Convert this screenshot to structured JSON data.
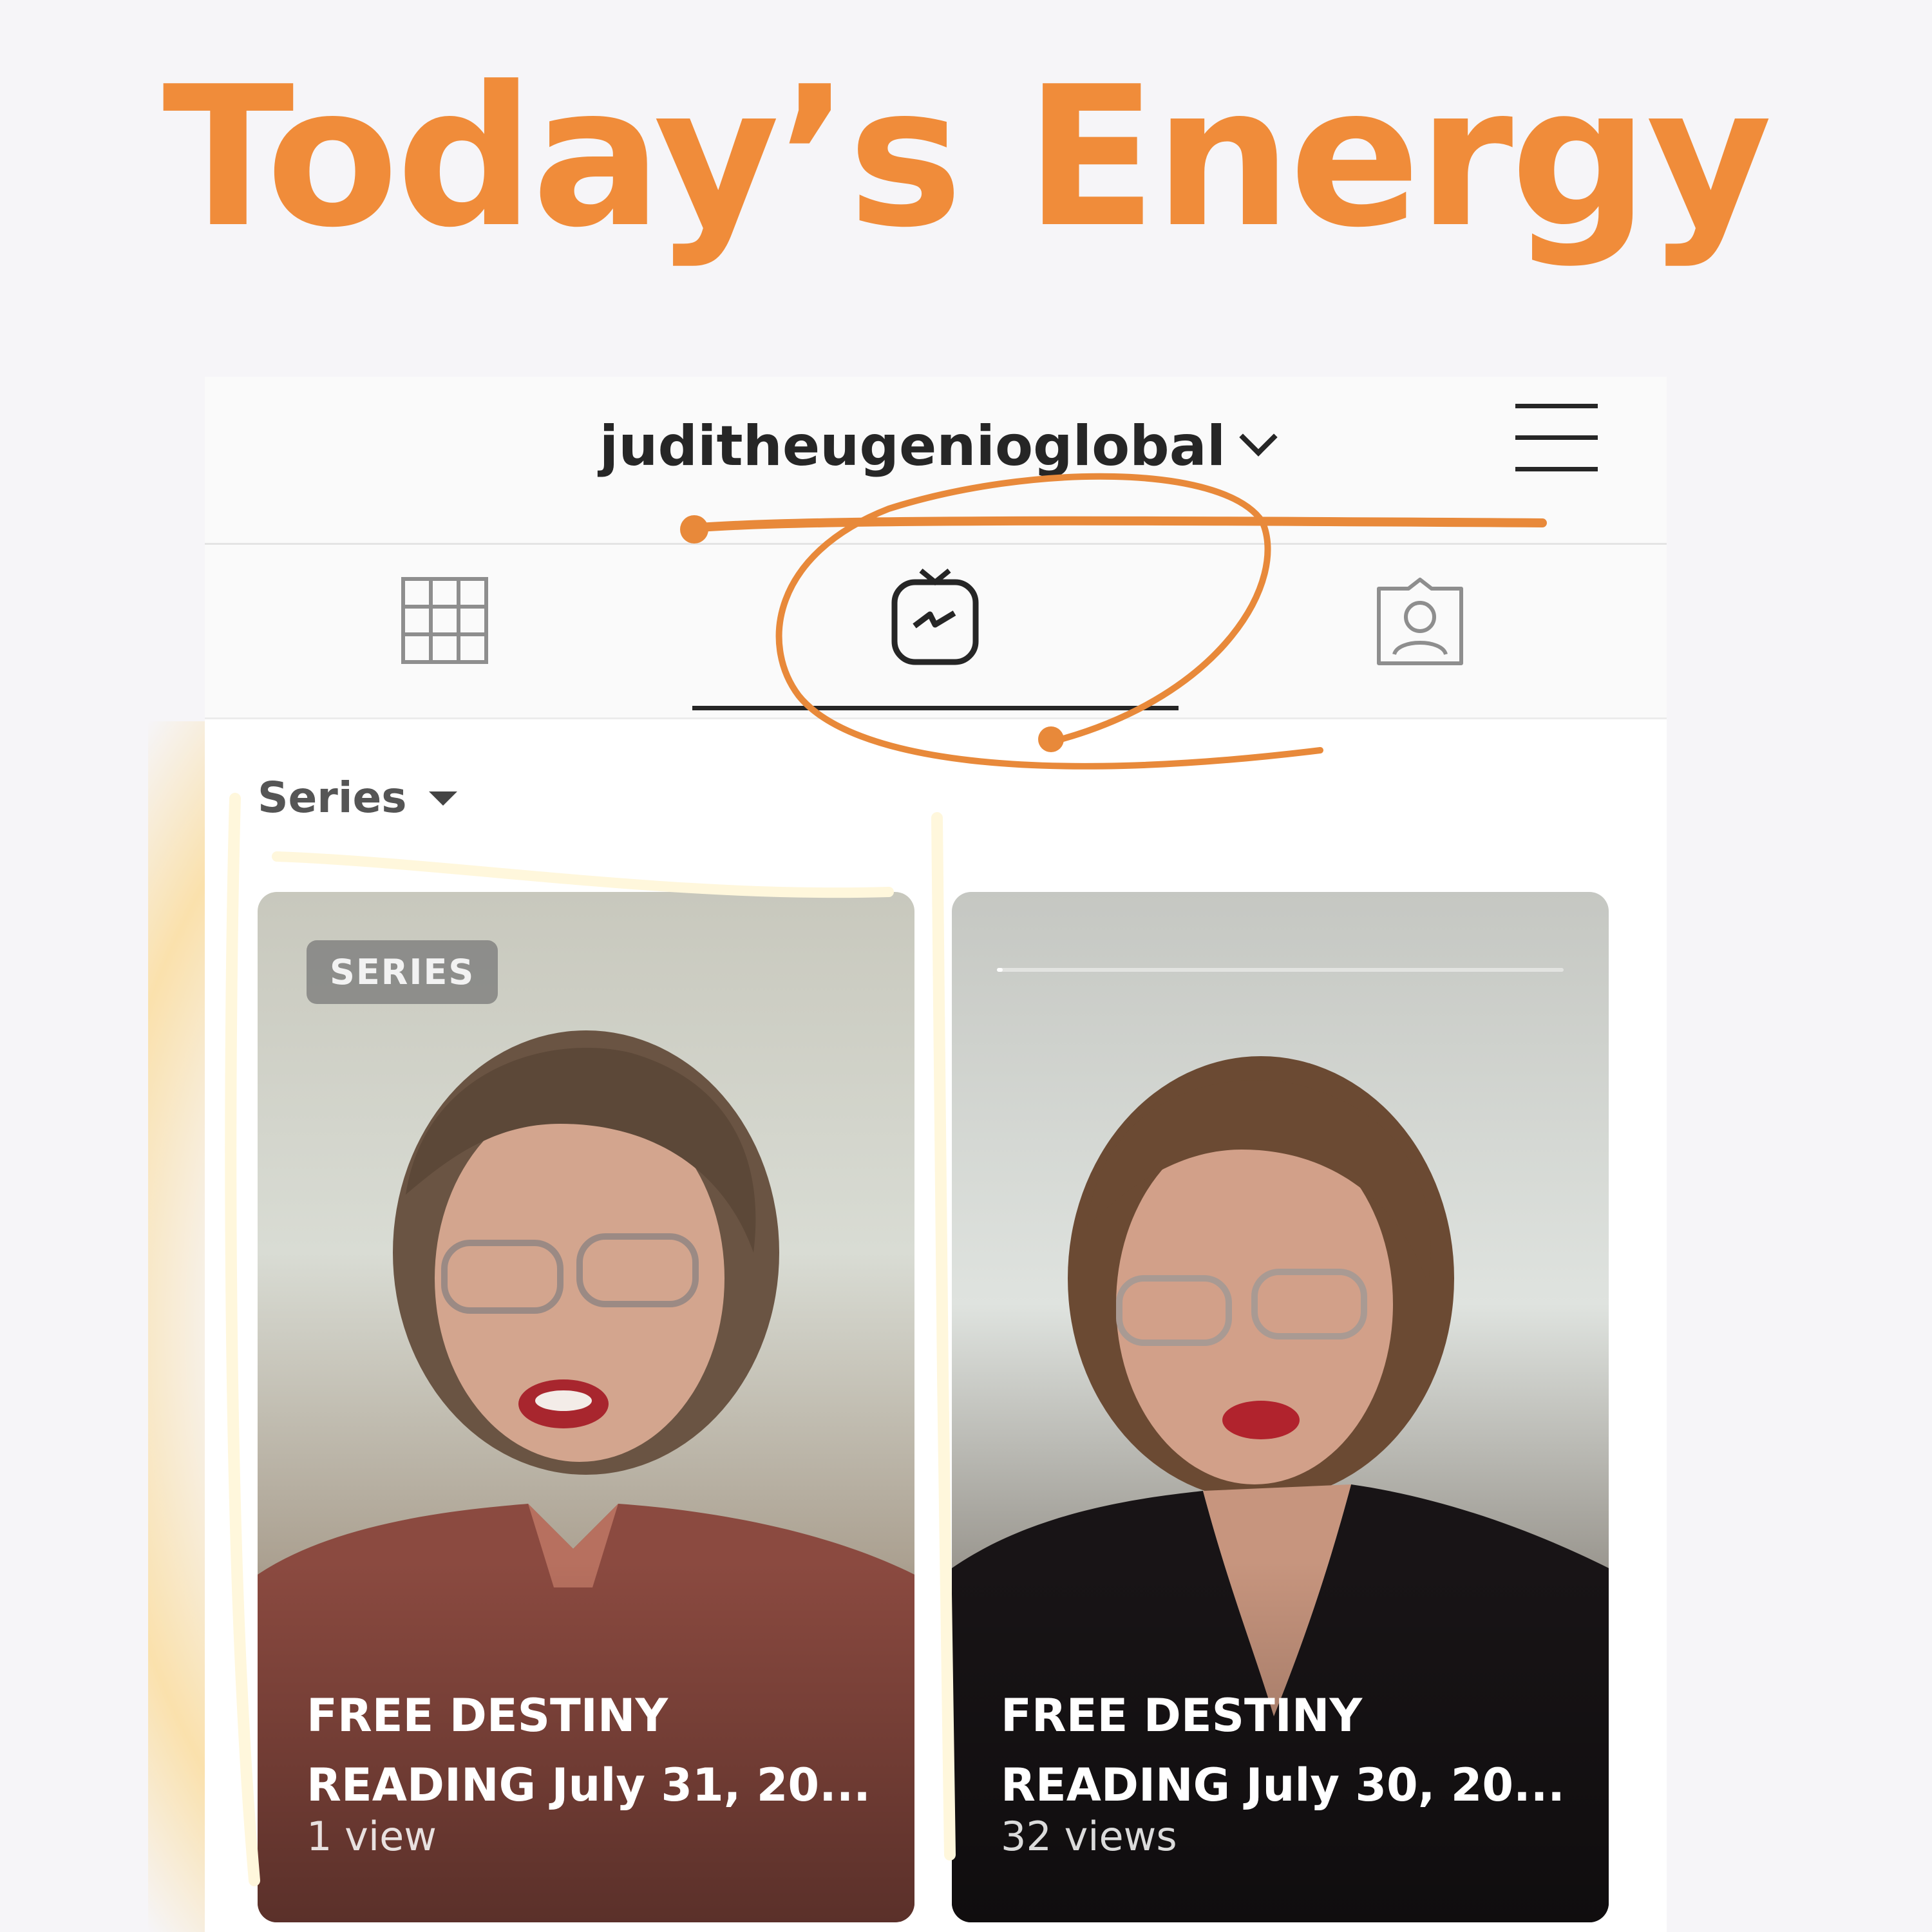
{
  "headline": "Today’s Energy",
  "header": {
    "username": "juditheugenioglobal",
    "dropdown_icon": "chevron-down-icon",
    "menu_icon": "hamburger-menu-icon"
  },
  "tabs": [
    {
      "name": "grid",
      "icon": "grid-icon",
      "active": false
    },
    {
      "name": "igtv",
      "icon": "igtv-icon",
      "active": true
    },
    {
      "name": "tagged",
      "icon": "tagged-person-icon",
      "active": false
    }
  ],
  "filter": {
    "label": "Series",
    "icon": "caret-down-icon"
  },
  "videos": [
    {
      "badge": "SERIES",
      "title": "FREE DESTINY READING July 31, 20...",
      "views": "1 view"
    },
    {
      "title": "FREE DESTINY READING July 30, 20...",
      "views": "32 views",
      "progress": 0.01
    }
  ],
  "colors": {
    "headline": "#f08c3a",
    "annotation": "#e8893a",
    "highlight_glow": "#ffd070",
    "text_dark": "#262626"
  }
}
